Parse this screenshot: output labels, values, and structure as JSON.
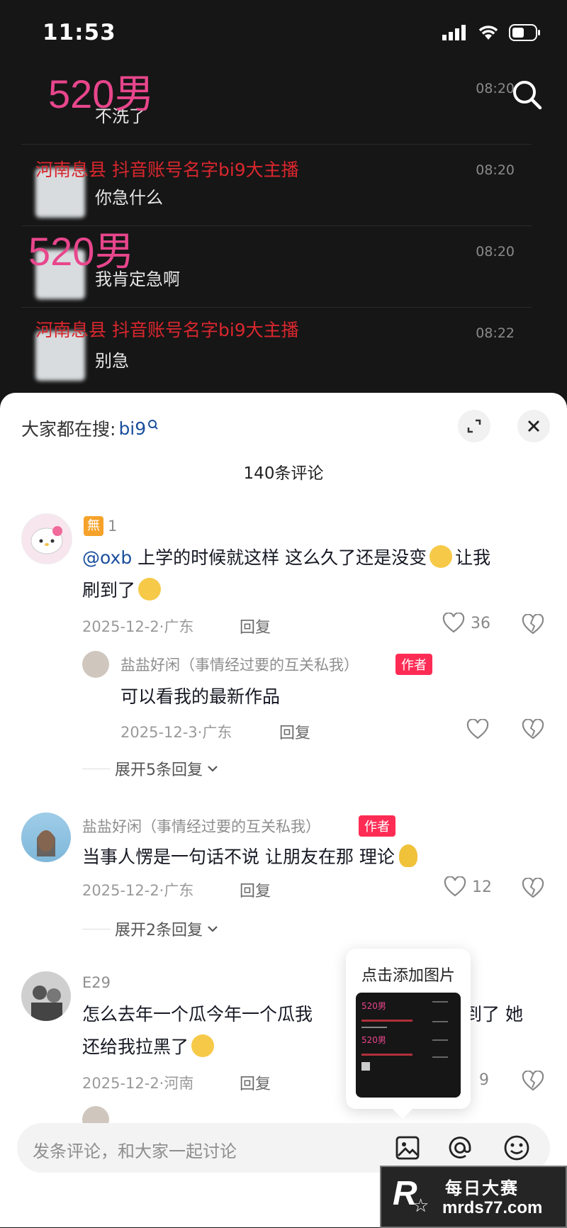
{
  "status": {
    "time": "11:53"
  },
  "chat": {
    "rows": [
      {
        "time": "08:20",
        "msg": "不洗了",
        "overlay": "520男"
      },
      {
        "time": "08:20",
        "msg": "你急什么",
        "overlay": "河南息县 抖音账号名字bi9大主播"
      },
      {
        "time": "08:20",
        "msg": "我肯定急啊",
        "overlay": "520男"
      },
      {
        "time": "08:22",
        "msg": "别急",
        "overlay": "河南息县 抖音账号名字bi9大主播"
      }
    ]
  },
  "sheet": {
    "search_prefix": "大家都在搜:",
    "search_term": "bi9",
    "comment_count": "140条评论",
    "comments": [
      {
        "badge": "無",
        "name": "1",
        "text_mention": "@oxb",
        "text_line1": "上学的时候就这样 这么久了还是没变",
        "text_line1_end": "让我",
        "text_line2": "刷到了",
        "date": "2025-12-2·广东",
        "reply": "回复",
        "likes": "36"
      },
      {
        "name": "盐盐好闲（事情经过要的互关私我）",
        "tag": "作者",
        "text": "可以看我的最新作品",
        "date": "2025-12-3·广东",
        "reply": "回复"
      },
      {
        "expand": "展开5条回复"
      },
      {
        "name": "盐盐好闲（事情经过要的互关私我）",
        "tag": "作者",
        "text": "当事人愣是一句话不说  让朋友在那 理论",
        "date": "2025-12-2·广东",
        "reply": "回复",
        "likes": "12"
      },
      {
        "expand": "展开2条回复"
      },
      {
        "name": "E29",
        "text_line1": "怎么去年一个瓜今年一个瓜我",
        "text_line1_end": "到了 她",
        "text_line2": "还给我拉黑了",
        "date": "2025-12-2·河南",
        "reply": "回复",
        "likes": "9"
      }
    ],
    "tooltip": "点击添加图片",
    "thumb": {
      "o1": "520男",
      "o2": "520男"
    },
    "input_placeholder": "发条评论，和大家一起讨论"
  },
  "watermark": {
    "title": "每日大赛",
    "url": "mrds77.com",
    "logo": "R"
  },
  "colors": {
    "accent": "#fe2c55",
    "overlay_pink": "#e8468c",
    "overlay_red": "#d9272e"
  }
}
